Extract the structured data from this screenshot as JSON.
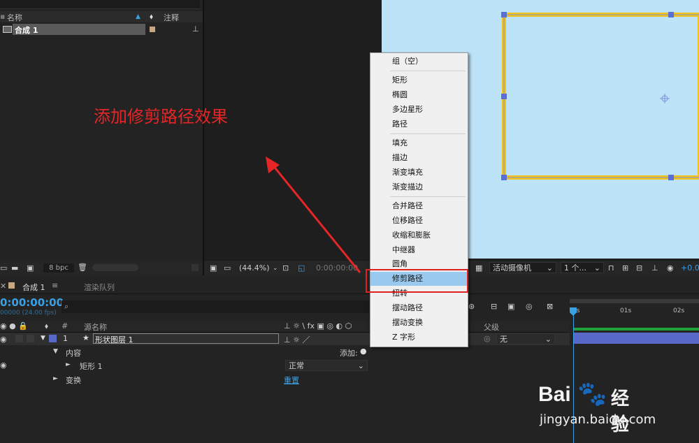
{
  "project": {
    "col_name": "名称",
    "col_comment": "注释",
    "item_name": "合成 1",
    "bpc": "8 bpc"
  },
  "viewer": {
    "zoom": "(44.4%)",
    "timecode": "0:00:00:00",
    "camera": "活动摄像机",
    "views": "1 个...",
    "exposure": "+0.0"
  },
  "timeline": {
    "tab_comp": "合成 1",
    "tab_render": "渲染队列",
    "timecode": "0:00:00:00",
    "timecode_sub": "00000 (24.00 fps)",
    "col_hash": "#",
    "col_source": "源名称",
    "col_parent": "父级",
    "layer_num": "1",
    "layer_name": "形状图层 1",
    "parent_value": "无",
    "content_label": "内容",
    "add_label": "添加:",
    "rect_label": "矩形 1",
    "blend_mode": "正常",
    "transform_label": "变换",
    "reset_label": "重置",
    "ruler_0": "0s",
    "ruler_1": "01s",
    "ruler_2": "02s"
  },
  "menu": {
    "group_empty": "组（空）",
    "rect": "矩形",
    "ellipse": "椭圆",
    "polystar": "多边星形",
    "path": "路径",
    "fill": "填充",
    "stroke": "描边",
    "gradient_fill": "渐变填充",
    "gradient_stroke": "渐变描边",
    "merge_paths": "合并路径",
    "offset_paths": "位移路径",
    "pucker_bloat": "收缩和膨胀",
    "repeater": "中继器",
    "round_corners": "圆角",
    "trim_paths": "修剪路径",
    "twist": "扭转",
    "wiggle_paths": "摆动路径",
    "wiggle_transform": "摆动变换",
    "zigzag": "Z 字形"
  },
  "annotation": "添加修剪路径效果",
  "watermark": {
    "brand": "Bai",
    "brand2": "经验",
    "url": "jingyan.baidu.com"
  },
  "colors": {
    "accent_blue": "#3aa0e6",
    "menu_highlight": "#99c9ef",
    "annotation_red": "#e62626",
    "shape_stroke": "#f2c318",
    "canvas_bg": "#bde3f8"
  }
}
